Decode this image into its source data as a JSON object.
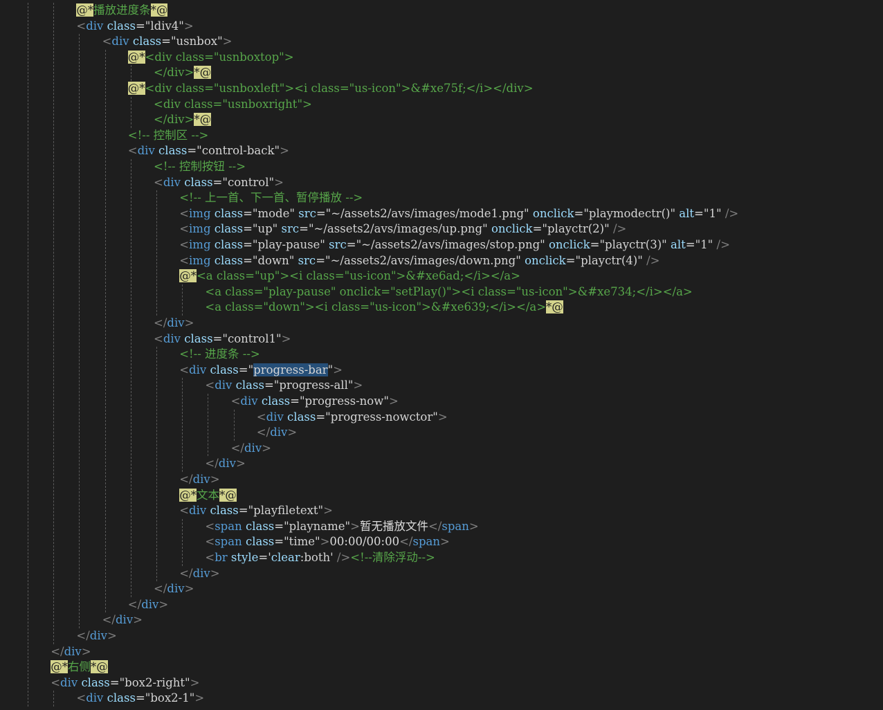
{
  "lines": [
    {
      "indent": 2,
      "tokens": [
        [
          "rz",
          "@*"
        ],
        [
          "rz-c",
          "播放进度条"
        ],
        [
          "rz",
          "*@"
        ]
      ]
    },
    {
      "indent": 2,
      "tokens": [
        [
          "br",
          "<"
        ],
        [
          "tg",
          "div"
        ],
        [
          "tx",
          " "
        ],
        [
          "at",
          "class"
        ],
        [
          "tx",
          "="
        ],
        [
          "st",
          "\"ldiv4\""
        ],
        [
          "br",
          ">"
        ]
      ]
    },
    {
      "indent": 3,
      "tokens": [
        [
          "br",
          "<"
        ],
        [
          "tg",
          "div"
        ],
        [
          "tx",
          " "
        ],
        [
          "at",
          "class"
        ],
        [
          "tx",
          "="
        ],
        [
          "st",
          "\"usnbox\""
        ],
        [
          "br",
          ">"
        ]
      ]
    },
    {
      "indent": 4,
      "tokens": [
        [
          "rz",
          "@*"
        ],
        [
          "cm",
          "<div class=\"usnboxtop\">"
        ]
      ]
    },
    {
      "indent": 5,
      "tokens": [
        [
          "cm",
          "</div>"
        ],
        [
          "rz",
          "*@"
        ]
      ]
    },
    {
      "indent": 4,
      "tokens": [
        [
          "rz",
          "@*"
        ],
        [
          "cm",
          "<div class=\"usnboxleft\"><i class=\"us-icon\">&#xe75f;</i></div>"
        ]
      ]
    },
    {
      "indent": 5,
      "tokens": [
        [
          "cm",
          "<div class=\"usnboxright\">"
        ]
      ]
    },
    {
      "indent": 5,
      "tokens": [
        [
          "cm",
          "</div>"
        ],
        [
          "rz",
          "*@"
        ]
      ]
    },
    {
      "indent": 4,
      "tokens": [
        [
          "cm",
          "<!-- 控制区 -->"
        ]
      ]
    },
    {
      "indent": 4,
      "tokens": [
        [
          "br",
          "<"
        ],
        [
          "tg",
          "div"
        ],
        [
          "tx",
          " "
        ],
        [
          "at",
          "class"
        ],
        [
          "tx",
          "="
        ],
        [
          "st",
          "\"control-back\""
        ],
        [
          "br",
          ">"
        ]
      ]
    },
    {
      "indent": 5,
      "tokens": [
        [
          "cm",
          "<!-- 控制按钮 -->"
        ]
      ]
    },
    {
      "indent": 5,
      "tokens": [
        [
          "br",
          "<"
        ],
        [
          "tg",
          "div"
        ],
        [
          "tx",
          " "
        ],
        [
          "at",
          "class"
        ],
        [
          "tx",
          "="
        ],
        [
          "st",
          "\"control\""
        ],
        [
          "br",
          ">"
        ]
      ]
    },
    {
      "indent": 6,
      "tokens": [
        [
          "cm",
          "<!-- 上一首、下一首、暂停播放 -->"
        ]
      ]
    },
    {
      "indent": 6,
      "tokens": [
        [
          "br",
          "<"
        ],
        [
          "tg",
          "img"
        ],
        [
          "tx",
          " "
        ],
        [
          "at",
          "class"
        ],
        [
          "tx",
          "="
        ],
        [
          "st",
          "\"mode\""
        ],
        [
          "tx",
          " "
        ],
        [
          "at",
          "src"
        ],
        [
          "tx",
          "="
        ],
        [
          "st",
          "\"~/assets2/avs/images/mode1.png\""
        ],
        [
          "tx",
          " "
        ],
        [
          "at",
          "onclick"
        ],
        [
          "tx",
          "="
        ],
        [
          "st",
          "\"playmodectr()\""
        ],
        [
          "tx",
          " "
        ],
        [
          "at",
          "alt"
        ],
        [
          "tx",
          "="
        ],
        [
          "st",
          "\"1\""
        ],
        [
          "tx",
          " "
        ],
        [
          "br",
          "/>"
        ]
      ]
    },
    {
      "indent": 6,
      "tokens": [
        [
          "br",
          "<"
        ],
        [
          "tg",
          "img"
        ],
        [
          "tx",
          " "
        ],
        [
          "at",
          "class"
        ],
        [
          "tx",
          "="
        ],
        [
          "st",
          "\"up\""
        ],
        [
          "tx",
          " "
        ],
        [
          "at",
          "src"
        ],
        [
          "tx",
          "="
        ],
        [
          "st",
          "\"~/assets2/avs/images/up.png\""
        ],
        [
          "tx",
          " "
        ],
        [
          "at",
          "onclick"
        ],
        [
          "tx",
          "="
        ],
        [
          "st",
          "\"playctr(2)\""
        ],
        [
          "tx",
          " "
        ],
        [
          "br",
          "/>"
        ]
      ]
    },
    {
      "indent": 6,
      "tokens": [
        [
          "br",
          "<"
        ],
        [
          "tg",
          "img"
        ],
        [
          "tx",
          " "
        ],
        [
          "at",
          "class"
        ],
        [
          "tx",
          "="
        ],
        [
          "st",
          "\"play-pause\""
        ],
        [
          "tx",
          " "
        ],
        [
          "at",
          "src"
        ],
        [
          "tx",
          "="
        ],
        [
          "st",
          "\"~/assets2/avs/images/stop.png\""
        ],
        [
          "tx",
          " "
        ],
        [
          "at",
          "onclick"
        ],
        [
          "tx",
          "="
        ],
        [
          "st",
          "\"playctr(3)\""
        ],
        [
          "tx",
          " "
        ],
        [
          "at",
          "alt"
        ],
        [
          "tx",
          "="
        ],
        [
          "st",
          "\"1\""
        ],
        [
          "tx",
          " "
        ],
        [
          "br",
          "/>"
        ]
      ]
    },
    {
      "indent": 6,
      "tokens": [
        [
          "br",
          "<"
        ],
        [
          "tg",
          "img"
        ],
        [
          "tx",
          " "
        ],
        [
          "at",
          "class"
        ],
        [
          "tx",
          "="
        ],
        [
          "st",
          "\"down\""
        ],
        [
          "tx",
          " "
        ],
        [
          "at",
          "src"
        ],
        [
          "tx",
          "="
        ],
        [
          "st",
          "\"~/assets2/avs/images/down.png\""
        ],
        [
          "tx",
          " "
        ],
        [
          "at",
          "onclick"
        ],
        [
          "tx",
          "="
        ],
        [
          "st",
          "\"playctr(4)\""
        ],
        [
          "tx",
          " "
        ],
        [
          "br",
          "/>"
        ]
      ]
    },
    {
      "indent": 6,
      "tokens": [
        [
          "rz",
          "@*"
        ],
        [
          "cm",
          "<a class=\"up\"><i class=\"us-icon\">&#xe6ad;</i></a>"
        ]
      ]
    },
    {
      "indent": 7,
      "tokens": [
        [
          "cm",
          "<a class=\"play-pause\" onclick=\"setPlay()\"><i class=\"us-icon\">&#xe734;</i></a>"
        ]
      ]
    },
    {
      "indent": 7,
      "tokens": [
        [
          "cm",
          "<a class=\"down\"><i class=\"us-icon\">&#xe639;</i></a>"
        ],
        [
          "rz",
          "*@"
        ]
      ]
    },
    {
      "indent": 5,
      "tokens": [
        [
          "br",
          "</"
        ],
        [
          "tg",
          "div"
        ],
        [
          "br",
          ">"
        ]
      ]
    },
    {
      "indent": 5,
      "tokens": [
        [
          "br",
          "<"
        ],
        [
          "tg",
          "div"
        ],
        [
          "tx",
          " "
        ],
        [
          "at",
          "class"
        ],
        [
          "tx",
          "="
        ],
        [
          "st",
          "\"control1\""
        ],
        [
          "br",
          ">"
        ]
      ]
    },
    {
      "indent": 6,
      "tokens": [
        [
          "cm",
          "<!-- 进度条 -->"
        ]
      ]
    },
    {
      "indent": 6,
      "tokens": [
        [
          "br",
          "<"
        ],
        [
          "tg",
          "div"
        ],
        [
          "tx",
          " "
        ],
        [
          "at",
          "class"
        ],
        [
          "tx",
          "="
        ],
        [
          "st",
          "\""
        ],
        [
          "sel",
          "progress-bar"
        ],
        [
          "st",
          "\""
        ],
        [
          "br",
          ">"
        ]
      ]
    },
    {
      "indent": 7,
      "tokens": [
        [
          "br",
          "<"
        ],
        [
          "tg",
          "div"
        ],
        [
          "tx",
          " "
        ],
        [
          "at",
          "class"
        ],
        [
          "tx",
          "="
        ],
        [
          "st",
          "\"progress-all\""
        ],
        [
          "br",
          ">"
        ]
      ]
    },
    {
      "indent": 8,
      "tokens": [
        [
          "br",
          "<"
        ],
        [
          "tg",
          "div"
        ],
        [
          "tx",
          " "
        ],
        [
          "at",
          "class"
        ],
        [
          "tx",
          "="
        ],
        [
          "st",
          "\"progress-now\""
        ],
        [
          "br",
          ">"
        ]
      ]
    },
    {
      "indent": 9,
      "tokens": [
        [
          "br",
          "<"
        ],
        [
          "tg",
          "div"
        ],
        [
          "tx",
          " "
        ],
        [
          "at",
          "class"
        ],
        [
          "tx",
          "="
        ],
        [
          "st",
          "\"progress-nowctor\""
        ],
        [
          "br",
          ">"
        ]
      ]
    },
    {
      "indent": 9,
      "tokens": [
        [
          "br",
          "</"
        ],
        [
          "tg",
          "div"
        ],
        [
          "br",
          ">"
        ]
      ]
    },
    {
      "indent": 8,
      "tokens": [
        [
          "br",
          "</"
        ],
        [
          "tg",
          "div"
        ],
        [
          "br",
          ">"
        ]
      ]
    },
    {
      "indent": 7,
      "tokens": [
        [
          "br",
          "</"
        ],
        [
          "tg",
          "div"
        ],
        [
          "br",
          ">"
        ]
      ]
    },
    {
      "indent": 6,
      "tokens": [
        [
          "br",
          "</"
        ],
        [
          "tg",
          "div"
        ],
        [
          "br",
          ">"
        ]
      ]
    },
    {
      "indent": 6,
      "tokens": [
        [
          "rz",
          "@*"
        ],
        [
          "rz-c",
          "文本"
        ],
        [
          "rz",
          "*@"
        ]
      ]
    },
    {
      "indent": 6,
      "tokens": [
        [
          "br",
          "<"
        ],
        [
          "tg",
          "div"
        ],
        [
          "tx",
          " "
        ],
        [
          "at",
          "class"
        ],
        [
          "tx",
          "="
        ],
        [
          "st",
          "\"playfiletext\""
        ],
        [
          "br",
          ">"
        ]
      ]
    },
    {
      "indent": 7,
      "tokens": [
        [
          "br",
          "<"
        ],
        [
          "tg",
          "span"
        ],
        [
          "tx",
          " "
        ],
        [
          "at",
          "class"
        ],
        [
          "tx",
          "="
        ],
        [
          "st",
          "\"playname\""
        ],
        [
          "br",
          ">"
        ],
        [
          "tx",
          "暂无播放文件"
        ],
        [
          "br",
          "</"
        ],
        [
          "tg",
          "span"
        ],
        [
          "br",
          ">"
        ]
      ]
    },
    {
      "indent": 7,
      "tokens": [
        [
          "br",
          "<"
        ],
        [
          "tg",
          "span"
        ],
        [
          "tx",
          " "
        ],
        [
          "at",
          "class"
        ],
        [
          "tx",
          "="
        ],
        [
          "st",
          "\"time\""
        ],
        [
          "br",
          ">"
        ],
        [
          "tx",
          "00:00/00:00"
        ],
        [
          "br",
          "</"
        ],
        [
          "tg",
          "span"
        ],
        [
          "br",
          ">"
        ]
      ]
    },
    {
      "indent": 7,
      "tokens": [
        [
          "br",
          "<"
        ],
        [
          "tg",
          "br"
        ],
        [
          "tx",
          " "
        ],
        [
          "at",
          "style"
        ],
        [
          "tx",
          "="
        ],
        [
          "st",
          "'"
        ],
        [
          "at",
          "clear"
        ],
        [
          "tx",
          ":"
        ],
        [
          "st",
          "both'"
        ],
        [
          "tx",
          " "
        ],
        [
          "br",
          "/>"
        ],
        [
          "cm",
          "<!--清除浮动-->"
        ]
      ]
    },
    {
      "indent": 6,
      "tokens": [
        [
          "br",
          "</"
        ],
        [
          "tg",
          "div"
        ],
        [
          "br",
          ">"
        ]
      ]
    },
    {
      "indent": 5,
      "tokens": [
        [
          "br",
          "</"
        ],
        [
          "tg",
          "div"
        ],
        [
          "br",
          ">"
        ]
      ]
    },
    {
      "indent": 4,
      "tokens": [
        [
          "br",
          "</"
        ],
        [
          "tg",
          "div"
        ],
        [
          "br",
          ">"
        ]
      ]
    },
    {
      "indent": 3,
      "tokens": [
        [
          "br",
          "</"
        ],
        [
          "tg",
          "div"
        ],
        [
          "br",
          ">"
        ]
      ]
    },
    {
      "indent": 2,
      "tokens": [
        [
          "br",
          "</"
        ],
        [
          "tg",
          "div"
        ],
        [
          "br",
          ">"
        ]
      ]
    },
    {
      "indent": 1,
      "tokens": [
        [
          "br",
          "</"
        ],
        [
          "tg",
          "div"
        ],
        [
          "br",
          ">"
        ]
      ]
    },
    {
      "indent": 1,
      "tokens": [
        [
          "rz",
          "@*"
        ],
        [
          "rz-c",
          "右侧"
        ],
        [
          "rz",
          "*@"
        ]
      ]
    },
    {
      "indent": 1,
      "tokens": [
        [
          "br",
          "<"
        ],
        [
          "tg",
          "div"
        ],
        [
          "tx",
          " "
        ],
        [
          "at",
          "class"
        ],
        [
          "tx",
          "="
        ],
        [
          "st",
          "\"box2-right\""
        ],
        [
          "br",
          ">"
        ]
      ]
    },
    {
      "indent": 2,
      "tokens": [
        [
          "br",
          "<"
        ],
        [
          "tg",
          "div"
        ],
        [
          "tx",
          " "
        ],
        [
          "at",
          "class"
        ],
        [
          "tx",
          "="
        ],
        [
          "st",
          "\"box2-1\""
        ],
        [
          "br",
          ">"
        ]
      ]
    }
  ]
}
